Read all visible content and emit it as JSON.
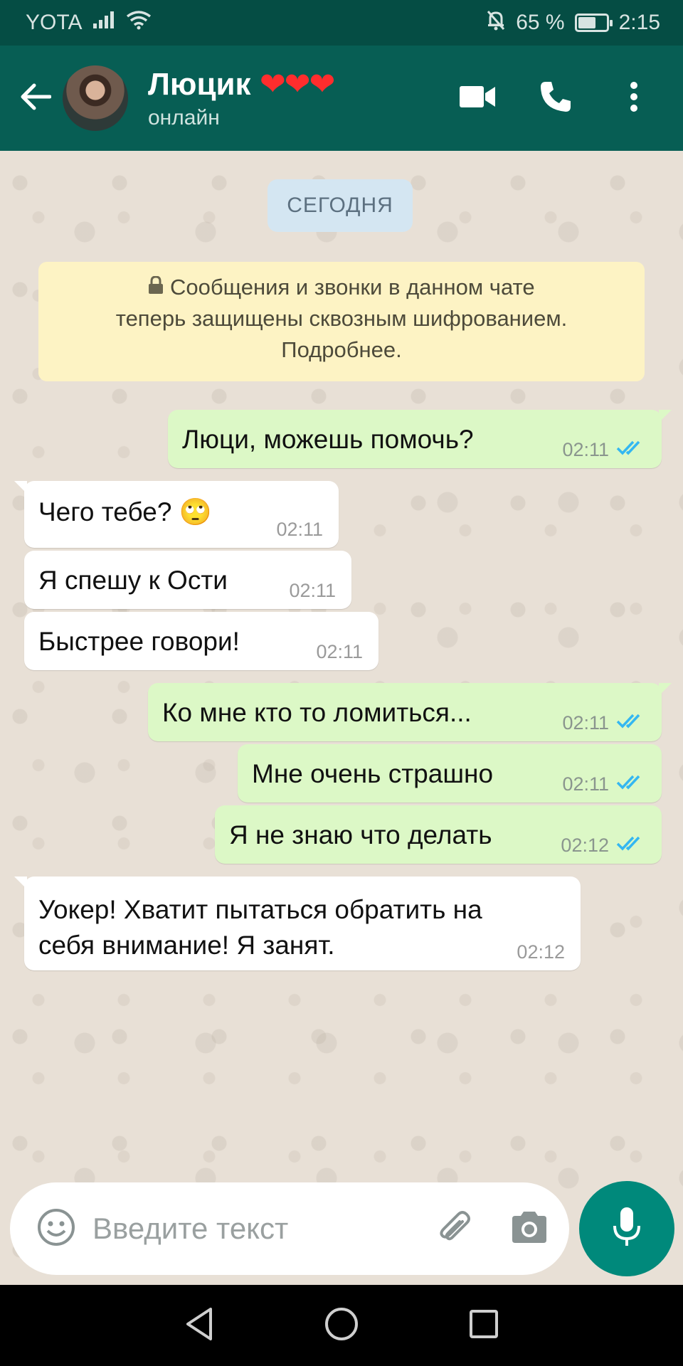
{
  "status_bar": {
    "carrier": "YOTA",
    "battery": "65 %",
    "battery_level": 0.65,
    "time": "2:15",
    "icons": [
      "signal-icon",
      "wifi-icon",
      "muted-bell-icon",
      "battery-icon"
    ]
  },
  "header": {
    "contact_name": "Люцик",
    "contact_hearts": "❤❤❤",
    "status": "онлайн",
    "icons": [
      "back-arrow-icon",
      "video-call-icon",
      "phone-icon",
      "more-vert-icon"
    ]
  },
  "chat": {
    "date_chip": "СЕГОДНЯ",
    "encryption_notice": {
      "line1": "Сообщения и звонки в данном чате",
      "line2": "теперь защищены сквозным шифрованием.",
      "line3": "Подробнее."
    },
    "messages": [
      {
        "direction": "out",
        "text": "Люци, можешь помочь?",
        "time": "02:11",
        "status": "read"
      },
      {
        "direction": "in",
        "text": "Чего тебе? 🙄",
        "time": "02:11"
      },
      {
        "direction": "in",
        "text": "Я спешу к Ости",
        "time": "02:11"
      },
      {
        "direction": "in",
        "text": "Быстрее говори!",
        "time": "02:11"
      },
      {
        "direction": "out",
        "text": "Ко мне кто то ломиться...",
        "time": "02:11",
        "status": "read"
      },
      {
        "direction": "out",
        "text": "Мне очень страшно",
        "time": "02:11",
        "status": "read"
      },
      {
        "direction": "out",
        "text": "Я не знаю что делать",
        "time": "02:12",
        "status": "read"
      },
      {
        "direction": "in",
        "text_line1": "Уокер! Хватит пытаться обратить на",
        "text_line2": "себя внимание! Я занят.",
        "time": "02:12"
      }
    ]
  },
  "input_bar": {
    "placeholder": "Введите текст",
    "icons": [
      "emoji-icon",
      "paperclip-icon",
      "camera-icon",
      "mic-icon"
    ]
  },
  "colors": {
    "header": "#075e54",
    "status_bar": "#054d44",
    "outgoing_bubble": "#dcf8c6",
    "incoming_bubble": "#ffffff",
    "notice": "#fdf3c4",
    "read_ticks": "#34b7f1",
    "mic_button": "#00897b"
  }
}
